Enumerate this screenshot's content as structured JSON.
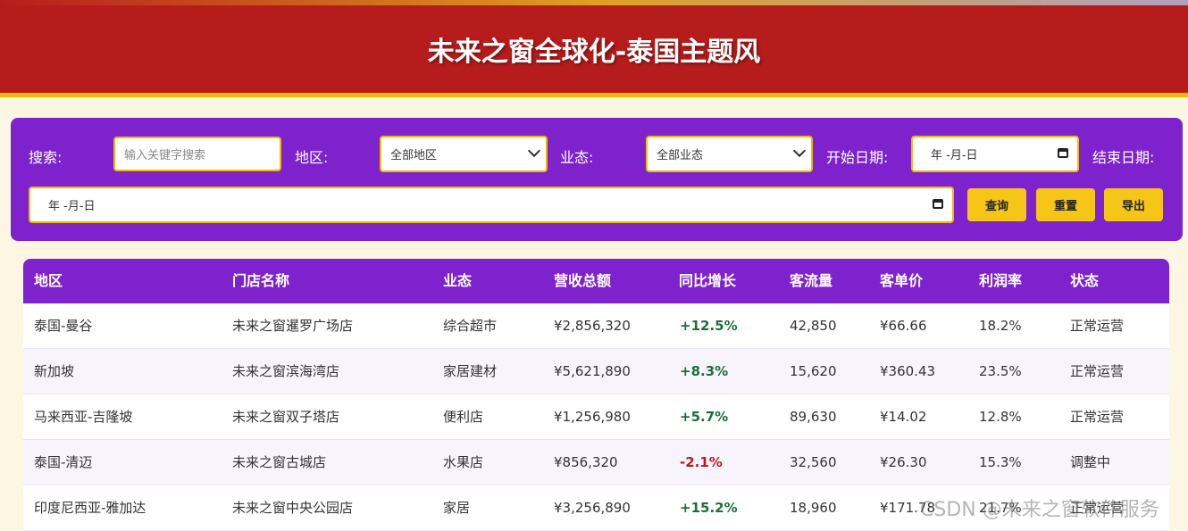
{
  "header": {
    "title": "未来之窗全球化-泰国主题风"
  },
  "filters": {
    "search_label": "搜索:",
    "search_placeholder": "输入关键字搜索",
    "region_label": "地区:",
    "region_value": "全部地区",
    "format_label": "业态:",
    "format_value": "全部业态",
    "start_label": "开始日期:",
    "start_value": "年 -月-日",
    "end_label": "结束日期:",
    "end_value": "年 -月-日"
  },
  "buttons": {
    "query": "查询",
    "reset": "重置",
    "export": "导出"
  },
  "table": {
    "headers": [
      "地区",
      "门店名称",
      "业态",
      "营收总额",
      "同比增长",
      "客流量",
      "客单价",
      "利润率",
      "状态"
    ],
    "rows": [
      [
        "泰国-曼谷",
        "未来之窗暹罗广场店",
        "综合超市",
        "¥2,856,320",
        "+12.5%",
        "42,850",
        "¥66.66",
        "18.2%",
        "正常运营"
      ],
      [
        "新加坡",
        "未来之窗滨海湾店",
        "家居建材",
        "¥5,621,890",
        "+8.3%",
        "15,620",
        "¥360.43",
        "23.5%",
        "正常运营"
      ],
      [
        "马来西亚-吉隆坡",
        "未来之窗双子塔店",
        "便利店",
        "¥1,256,980",
        "+5.7%",
        "89,630",
        "¥14.02",
        "12.8%",
        "正常运营"
      ],
      [
        "泰国-清迈",
        "未来之窗古城店",
        "水果店",
        "¥856,320",
        "-2.1%",
        "32,560",
        "¥26.30",
        "15.3%",
        "调整中"
      ],
      [
        "印度尼西亚-雅加达",
        "未来之窗中央公园店",
        "家居",
        "¥3,256,890",
        "+15.2%",
        "18,960",
        "¥171.78",
        "21.7%",
        "正常运营"
      ]
    ]
  },
  "watermark": "CSDN @未来之窗软件服务",
  "colors": {
    "header_bg": "#b71c1c",
    "accent": "#f5b800",
    "panel_bg": "#7e22ce",
    "positive": "#1e6e3c",
    "negative": "#c0161d"
  }
}
